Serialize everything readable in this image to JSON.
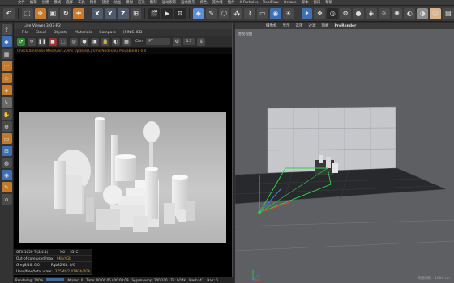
{
  "menubar": {
    "items": [
      "文件",
      "编辑",
      "创建",
      "模式",
      "选择",
      "工具",
      "网格",
      "捕捉",
      "动画",
      "模拟",
      "渲染",
      "雕刻",
      "运动跟踪",
      "运动图形",
      "角色",
      "流水线",
      "插件",
      "X-Particles",
      "RealFlow",
      "Octane",
      "脚本",
      "窗口",
      "帮助"
    ]
  },
  "toolbar": {
    "axis_x": "X",
    "axis_y": "Y",
    "axis_z": "Z"
  },
  "live_viewer": {
    "title": "Live Viewer 3.07-R2",
    "menu": [
      "File",
      "Cloud",
      "Objects",
      "Materials",
      "Compare",
      "[FINISHED]"
    ],
    "channel_label": "Chnl",
    "channel_value": "PT",
    "zoom_value": "0.3",
    "status_line": "Check:0ms/0ms MeshGen:20ms Update[C]:0ms Nodes:83 Movable:81 0 0",
    "stats": [
      {
        "label": "GTX 1050 Ti(2/4.1)",
        "value": "%0",
        "extra": "55°C"
      },
      {
        "label": "Out-of-core used/max:",
        "value": "0Kb/4Gb",
        "extra": ""
      },
      {
        "label": "Grey8/16: 0/0",
        "value": "Rgb32/64: 0/0",
        "extra": ""
      },
      {
        "label": "Used/free/total vram:",
        "value": "375Mb/2.419Gb/4Gb",
        "extra": ""
      }
    ],
    "render_bar": {
      "rendering_label": "Rendering: 100%",
      "ms_label": "Ms/sec: 0",
      "time_label": "Time: 00:00:06 / 00:00:09",
      "spp_label": "Spp/maxspp: 100/100",
      "tri_label": "Tri: 0/14k",
      "mesh_label": "Mesh: 41",
      "hair_label": "Hair: 0"
    }
  },
  "viewport": {
    "menu": [
      "摄像机",
      "显示",
      "选项",
      "过滤",
      "面板",
      "ProRender"
    ],
    "label": "透视视图",
    "footer": "网格间距：1000 cm"
  },
  "colors": {
    "accent_orange": "#c97a2a",
    "accent_blue": "#3f6fb3",
    "gizmo_green": "#2fd04a",
    "gizmo_red": "#e0442e",
    "gizmo_blue": "#3a7fff"
  }
}
